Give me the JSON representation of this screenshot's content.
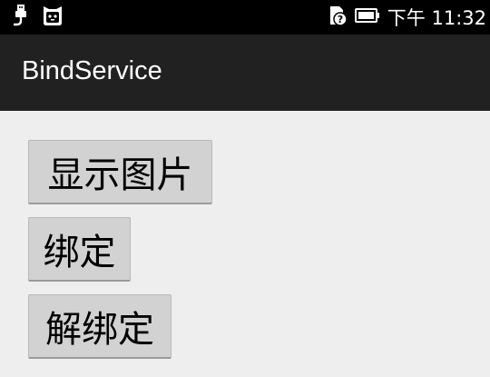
{
  "status_bar": {
    "time": "下午 11:32",
    "icons": [
      "usb-icon",
      "cat-face-icon",
      "sim-unknown-icon",
      "battery-icon"
    ]
  },
  "app": {
    "title": "BindService"
  },
  "buttons": {
    "show_image": "显示图片",
    "bind": "绑定",
    "unbind": "解绑定"
  },
  "colors": {
    "status_bar": "#000000",
    "action_bar": "#212121",
    "background": "#eeeeee",
    "button": "#d2d2d2"
  }
}
